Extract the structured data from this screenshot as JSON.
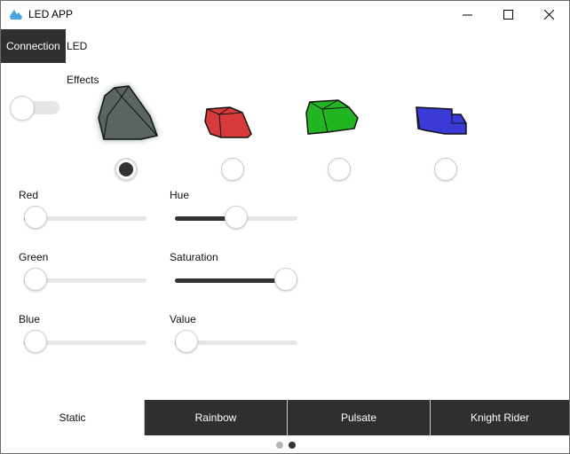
{
  "window": {
    "title": "LED APP",
    "controls": [
      "minimize",
      "maximize",
      "close"
    ]
  },
  "top_tabs": [
    {
      "label": "Connection",
      "active": true
    },
    {
      "label": "LED Effects",
      "active": false
    }
  ],
  "power_toggle": {
    "on": false
  },
  "leds": [
    {
      "name": "gray",
      "color": "#5a6563",
      "selected": true
    },
    {
      "name": "red",
      "color": "#d63a3a",
      "selected": false
    },
    {
      "name": "green",
      "color": "#22b522",
      "selected": false
    },
    {
      "name": "blue",
      "color": "#3a3ad6",
      "selected": false
    }
  ],
  "sliders": {
    "red": {
      "label": "Red",
      "level": 0.0
    },
    "green": {
      "label": "Green",
      "level": 0.03
    },
    "blue": {
      "label": "Blue",
      "level": 0.03
    },
    "hue": {
      "label": "Hue",
      "level": 0.5
    },
    "saturation": {
      "label": "Saturation",
      "level": 1.0
    },
    "value": {
      "label": "Value",
      "level": 0.03
    }
  },
  "bottom_tabs": [
    {
      "label": "Static",
      "active": true
    },
    {
      "label": "Rainbow",
      "active": false
    },
    {
      "label": "Pulsate",
      "active": false
    },
    {
      "label": "Knight Rider",
      "active": false
    }
  ],
  "page_indicator": {
    "count": 2,
    "current": 1
  },
  "colors": {
    "dark": "#2f2f2f",
    "track": "#e6e6e6",
    "accent_icon": "#4aa3df"
  }
}
